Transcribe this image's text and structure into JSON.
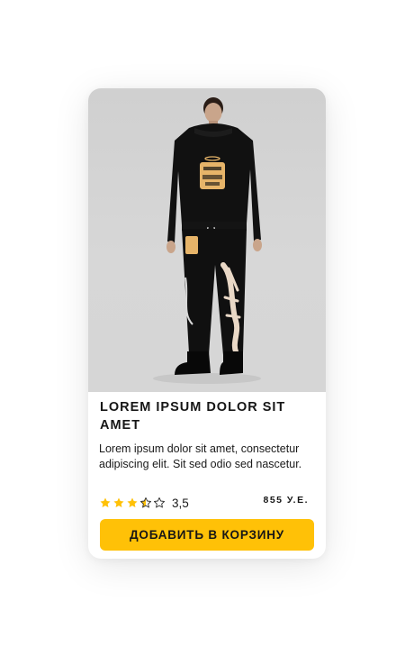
{
  "product": {
    "image_alt": "Model wearing black hoodie and black graffiti joggers",
    "title": "LOREM IPSUM DOLOR SIT AMET",
    "description": "Lorem ipsum dolor sit amet, consectetur adipiscing elit. Sit sed odio sed nascetur.",
    "rating": {
      "value_text": "3,5",
      "value": 3.5,
      "max": 5,
      "star_color": "#ffc107"
    },
    "price": "855 У.Е.",
    "add_to_cart_label": "ДОБАВИТЬ В КОРЗИНУ"
  },
  "colors": {
    "accent": "#ffc107",
    "text": "#161616",
    "image_background": "#d4d4d4"
  }
}
